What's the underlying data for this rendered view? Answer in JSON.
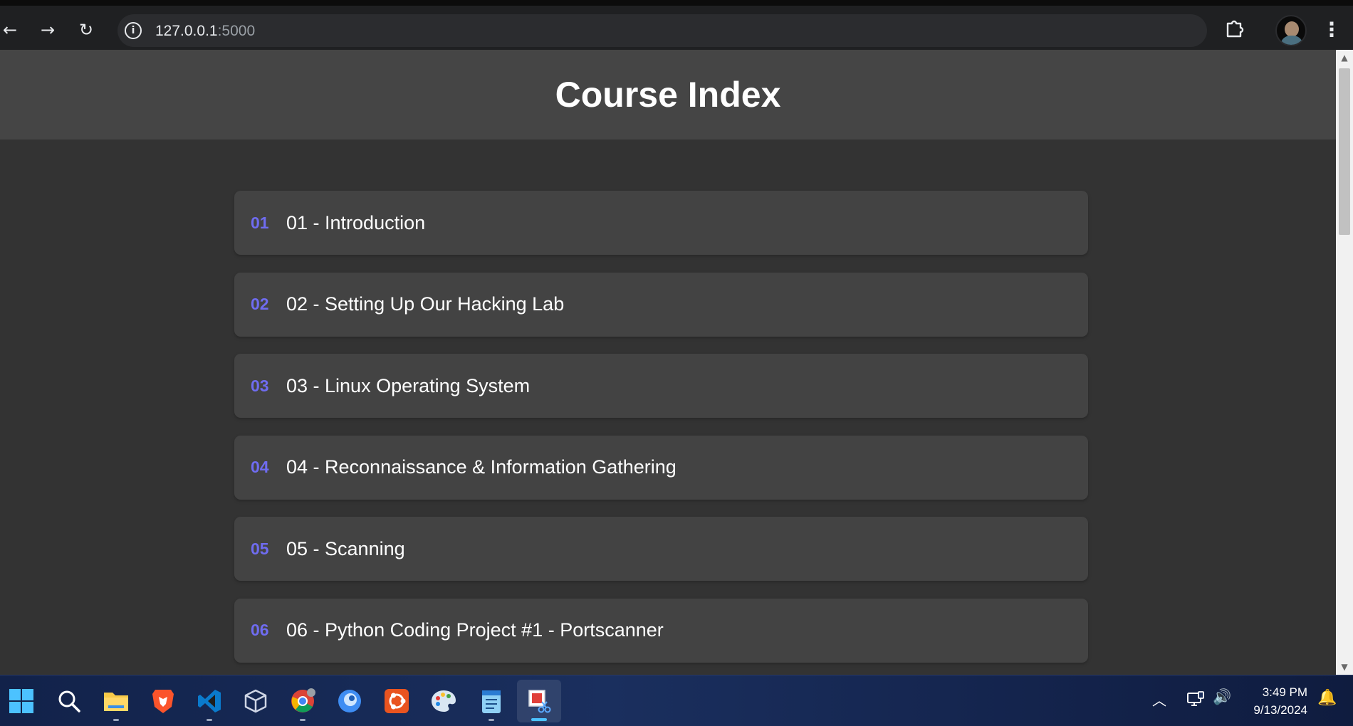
{
  "browser": {
    "url_host": "127.0.0.1",
    "url_port": ":5000",
    "back_icon": "←",
    "forward_icon": "→",
    "reload_icon": "↻",
    "info_icon": "i",
    "star_icon": "☆",
    "menu_icon": "⋮"
  },
  "page": {
    "title": "Course Index",
    "courses": [
      {
        "num": "01",
        "label": "01 - Introduction"
      },
      {
        "num": "02",
        "label": "02 - Setting Up Our Hacking Lab"
      },
      {
        "num": "03",
        "label": "03 - Linux Operating System"
      },
      {
        "num": "04",
        "label": "04 - Reconnaissance & Information Gathering"
      },
      {
        "num": "05",
        "label": "05 - Scanning"
      },
      {
        "num": "06",
        "label": "06 - Python Coding Project #1 - Portscanner"
      }
    ]
  },
  "scrollbar": {
    "up_icon": "▲",
    "down_icon": "▼"
  },
  "taskbar": {
    "apps": [
      "windows-start",
      "search",
      "file-explorer",
      "brave",
      "vscode",
      "virtualbox",
      "chrome",
      "app-blue",
      "ubuntu",
      "paint",
      "notepad",
      "snipping-tool"
    ],
    "tray": {
      "chevron_icon": "︿",
      "volume_icon": "🔊",
      "bell_icon": "🔔",
      "time": "3:49 PM",
      "date": "9/13/2024"
    }
  },
  "colors": {
    "accent_number": "#6f6cf0",
    "page_bg": "#333333",
    "header_bg": "#454545",
    "item_bg": "#434343"
  }
}
